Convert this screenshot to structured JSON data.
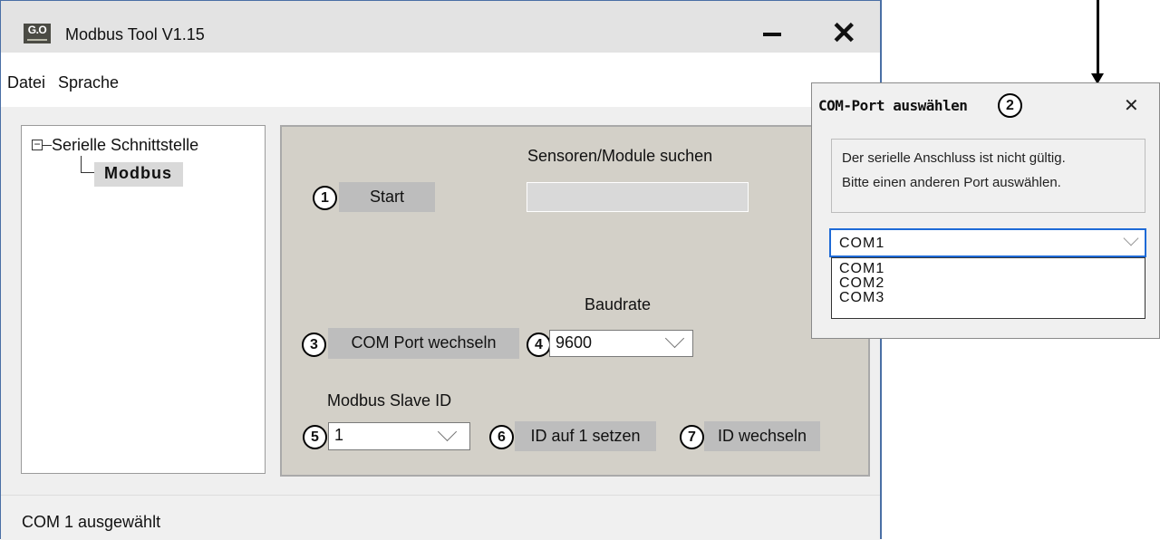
{
  "window": {
    "logo_text": "G.O",
    "title": "Modbus Tool V1.15",
    "minimize_glyph": "—",
    "close_glyph": "✕"
  },
  "menu": {
    "items": [
      "Datei",
      "Sprache"
    ]
  },
  "tree": {
    "expand_glyph": "−",
    "root_label": "Serielle Schnittstelle",
    "child_label": "Modbus"
  },
  "panel": {
    "search_label": "Sensoren/Module suchen",
    "start_button": "Start",
    "baud_label": "Baudrate",
    "com_port_button": "COM Port wechseln",
    "baud_value": "9600",
    "slave_id_label": "Modbus Slave ID",
    "slave_id_value": "1",
    "reset_id_button": "ID auf 1 setzen",
    "change_id_button": "ID wechseln"
  },
  "markers": {
    "m1": "1",
    "m2": "2",
    "m3": "3",
    "m4": "4",
    "m5": "5",
    "m6": "6",
    "m7": "7"
  },
  "status": {
    "text": "COM 1 ausgewählt"
  },
  "dialog": {
    "title": "COM-Port auswählen",
    "close_glyph": "✕",
    "message_line1": "Der serielle Anschluss ist nicht gültig.",
    "message_line2": "Bitte einen anderen Port auswählen.",
    "selected_port": "COM1",
    "options": [
      "COM1",
      "COM2",
      "COM3"
    ]
  }
}
